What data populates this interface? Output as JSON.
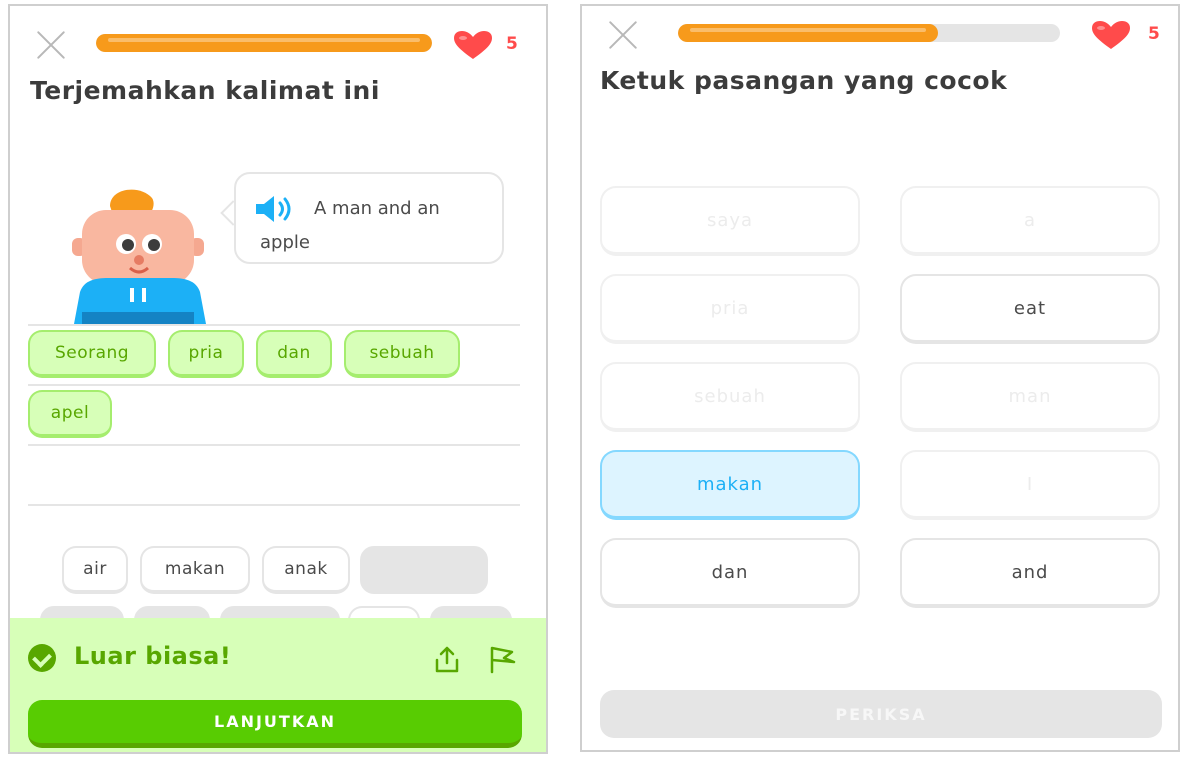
{
  "left_screen": {
    "hearts": "5",
    "progress": 1.0,
    "prompt_title": "Terjemahkan kalimat ini",
    "sentence": "A man and an apple",
    "answer_chips": [
      "Seorang",
      "pria",
      "dan",
      "sebuah",
      "apel"
    ],
    "word_bank": [
      "air",
      "makan",
      "anak"
    ],
    "feedback": "Luar biasa!",
    "continue_label": "LANJUTKAN"
  },
  "right_screen": {
    "hearts": "5",
    "progress": 0.68,
    "prompt_title": "Ketuk pasangan yang cocok",
    "left_words": [
      "saya",
      "pria",
      "sebuah",
      "makan",
      "dan"
    ],
    "right_words": [
      "a",
      "eat",
      "man",
      "I",
      "and"
    ],
    "check_label": "PERIKSA"
  },
  "colors": {
    "progress": "#f79a1b",
    "heart": "#ff4b4b",
    "correct_green": "#58cc02",
    "selected_blue": "#1cb0f6"
  }
}
